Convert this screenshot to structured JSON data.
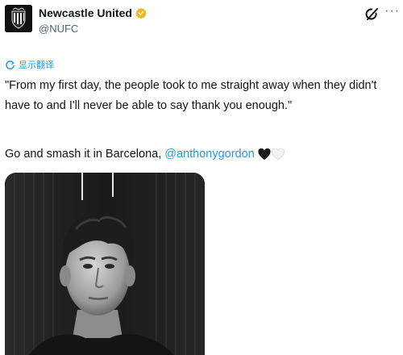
{
  "account": {
    "display_name": "Newcastle United",
    "handle": "@NUFC",
    "verified_color": "#e8b923"
  },
  "header_actions": {
    "grok": "grok-icon",
    "more": "more-icon"
  },
  "translate": {
    "label": "显示翻译",
    "icon": "translate-icon"
  },
  "tweet": {
    "paragraph1": "\"From my first day, the people took to me straight away when they didn't have to and I'll never be able to say thank you enough.\"",
    "paragraph2_prefix": "Go and smash it in Barcelona, ",
    "mention": "@anthonygordon",
    "emojis": [
      "black-heart",
      "white-heart"
    ]
  },
  "media": {
    "type": "photo",
    "style": "black-and-white portrait"
  },
  "colors": {
    "link": "#1d9bf0",
    "secondary_text": "#536471",
    "text": "#0f1419"
  }
}
